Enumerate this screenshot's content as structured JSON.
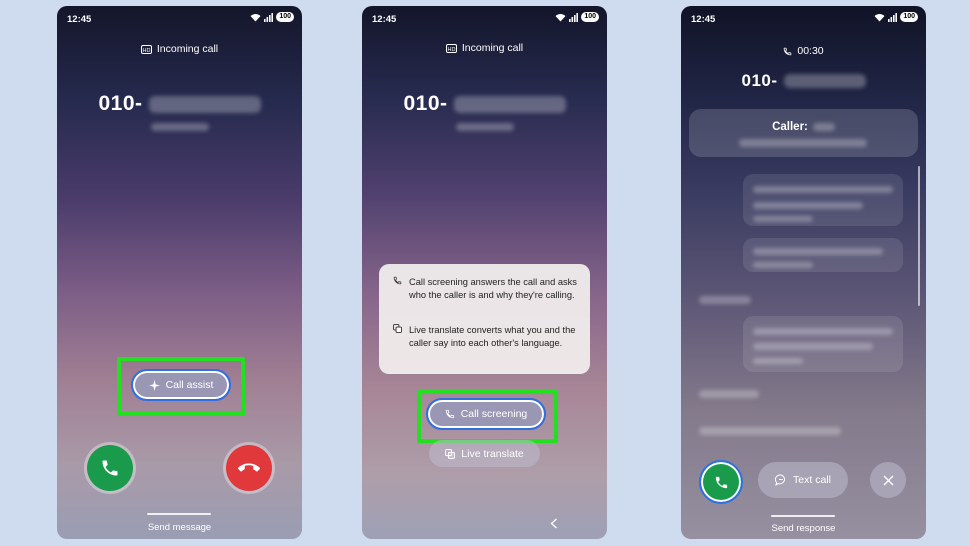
{
  "screens": [
    {
      "status_time": "12:45",
      "battery": "100",
      "call_label": "Incoming call",
      "number_prefix": "010-",
      "call_assist_label": "Call assist",
      "send_message_label": "Send message"
    },
    {
      "status_time": "12:45",
      "battery": "100",
      "call_label": "Incoming call",
      "number_prefix": "010-",
      "tooltip": {
        "screening_text": "Call screening answers the call and asks who the caller is and why they're calling.",
        "translate_text": "Live translate converts what you and the caller say into each other's language."
      },
      "call_screening_label": "Call screening",
      "live_translate_label": "Live translate"
    },
    {
      "status_time": "12:45",
      "battery": "100",
      "call_timer": "00:30",
      "number_prefix": "010-",
      "caller_label": "Caller:",
      "text_call_label": "Text call",
      "send_response_label": "Send response"
    }
  ],
  "colors": {
    "highlight": "#22e01f",
    "accept": "#1a9b4c",
    "decline": "#e0383b",
    "pill_border": "#2f6fe0"
  }
}
